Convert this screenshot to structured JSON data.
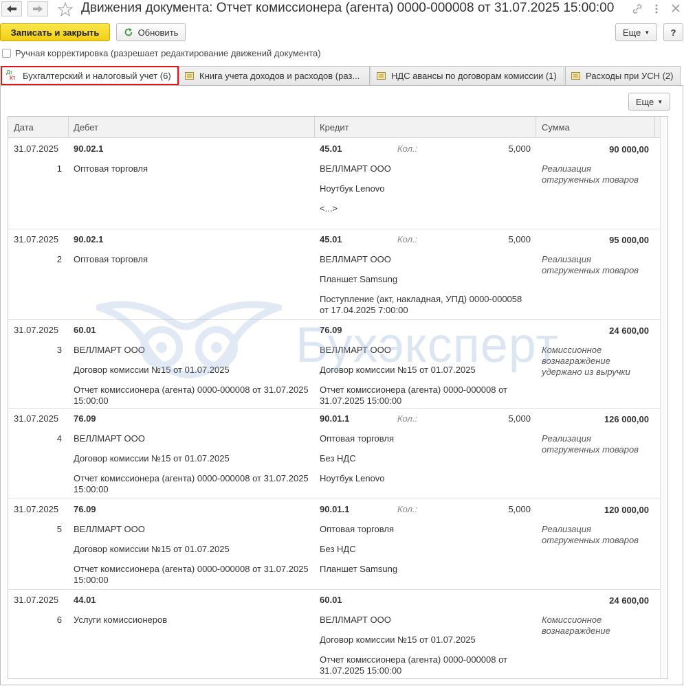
{
  "window": {
    "title": "Движения документа: Отчет комиссионера (агента) 0000-000008 от 31.07.2025 15:00:00"
  },
  "toolbar": {
    "save_close": "Записать и закрыть",
    "refresh": "Обновить",
    "more": "Еще",
    "help": "?"
  },
  "manual_correction": "Ручная корректировка (разрешает редактирование движений документа)",
  "tabs": [
    {
      "label": "Бухгалтерский и налоговый учет (6)"
    },
    {
      "label": "Книга учета доходов и расходов (раз..."
    },
    {
      "label": "НДС авансы по договорам комиссии (1)"
    },
    {
      "label": "Расходы при УСН (2)"
    }
  ],
  "grid": {
    "more": "Еще",
    "columns": {
      "date": "Дата",
      "debit": "Дебет",
      "credit": "Кредит",
      "sum": "Сумма"
    },
    "kol_label": "Кол.:",
    "rows": [
      {
        "date": "31.07.2025",
        "n": "1",
        "dt_acc": "90.02.1",
        "dt1": "Оптовая торговля",
        "dt2": "",
        "dt3a": "",
        "dt3b": "",
        "kt_acc": "45.01",
        "qty": "5,000",
        "kt1": "ВЕЛЛМАРТ ООО",
        "kt2": "Ноутбук Lenovo",
        "kt3a": "<...>",
        "kt3b": "",
        "sum": "90 000,00",
        "c1": "Реализация",
        "c2": "отгруженных товаров",
        "c3": ""
      },
      {
        "date": "31.07.2025",
        "n": "2",
        "dt_acc": "90.02.1",
        "dt1": "Оптовая торговля",
        "dt2": "",
        "dt3a": "",
        "dt3b": "",
        "kt_acc": "45.01",
        "qty": "5,000",
        "kt1": "ВЕЛЛМАРТ ООО",
        "kt2": "Планшет Samsung",
        "kt3a": "Поступление (акт, накладная, УПД) 0000-000058",
        "kt3b": "от 17.04.2025 7:00:00",
        "sum": "95 000,00",
        "c1": "Реализация",
        "c2": "отгруженных товаров",
        "c3": ""
      },
      {
        "date": "31.07.2025",
        "n": "3",
        "dt_acc": "60.01",
        "dt1": "ВЕЛЛМАРТ ООО",
        "dt2": "Договор комиссии №15 от 01.07.2025",
        "dt3a": "Отчет комиссионера (агента) 0000-000008 от 31.07.2025",
        "dt3b": "15:00:00",
        "kt_acc": "76.09",
        "qty": "",
        "kt1": "ВЕЛЛМАРТ ООО",
        "kt2": "Договор комиссии №15 от 01.07.2025",
        "kt3a": "Отчет комиссионера (агента) 0000-000008 от",
        "kt3b": "31.07.2025 15:00:00",
        "sum": "24 600,00",
        "c1": "Комиссионное",
        "c2": "вознаграждение",
        "c3": "удержано из выручки"
      },
      {
        "date": "31.07.2025",
        "n": "4",
        "dt_acc": "76.09",
        "dt1": "ВЕЛЛМАРТ ООО",
        "dt2": "Договор комиссии №15 от 01.07.2025",
        "dt3a": "Отчет комиссионера (агента) 0000-000008 от 31.07.2025",
        "dt3b": "15:00:00",
        "kt_acc": "90.01.1",
        "qty": "5,000",
        "kt1": "Оптовая торговля",
        "kt2": "Без НДС",
        "kt3a": "Ноутбук Lenovo",
        "kt3b": "",
        "sum": "126 000,00",
        "c1": "Реализация",
        "c2": "отгруженных товаров",
        "c3": ""
      },
      {
        "date": "31.07.2025",
        "n": "5",
        "dt_acc": "76.09",
        "dt1": "ВЕЛЛМАРТ ООО",
        "dt2": "Договор комиссии №15 от 01.07.2025",
        "dt3a": "Отчет комиссионера (агента) 0000-000008 от 31.07.2025",
        "dt3b": "15:00:00",
        "kt_acc": "90.01.1",
        "qty": "5,000",
        "kt1": "Оптовая торговля",
        "kt2": "Без НДС",
        "kt3a": "Планшет Samsung",
        "kt3b": "",
        "sum": "120 000,00",
        "c1": "Реализация",
        "c2": "отгруженных товаров",
        "c3": ""
      },
      {
        "date": "31.07.2025",
        "n": "6",
        "dt_acc": "44.01",
        "dt1": "Услуги комиссионеров",
        "dt2": "",
        "dt3a": "",
        "dt3b": "",
        "kt_acc": "60.01",
        "qty": "",
        "kt1": "ВЕЛЛМАРТ ООО",
        "kt2": "Договор комиссии №15 от 01.07.2025",
        "kt3a": "Отчет комиссионера (агента) 0000-000008 от",
        "kt3b": "31.07.2025 15:00:00",
        "sum": "24 600,00",
        "c1": "Комиссионное",
        "c2": "вознаграждение",
        "c3": ""
      }
    ]
  },
  "watermark": "Бухэксперт"
}
